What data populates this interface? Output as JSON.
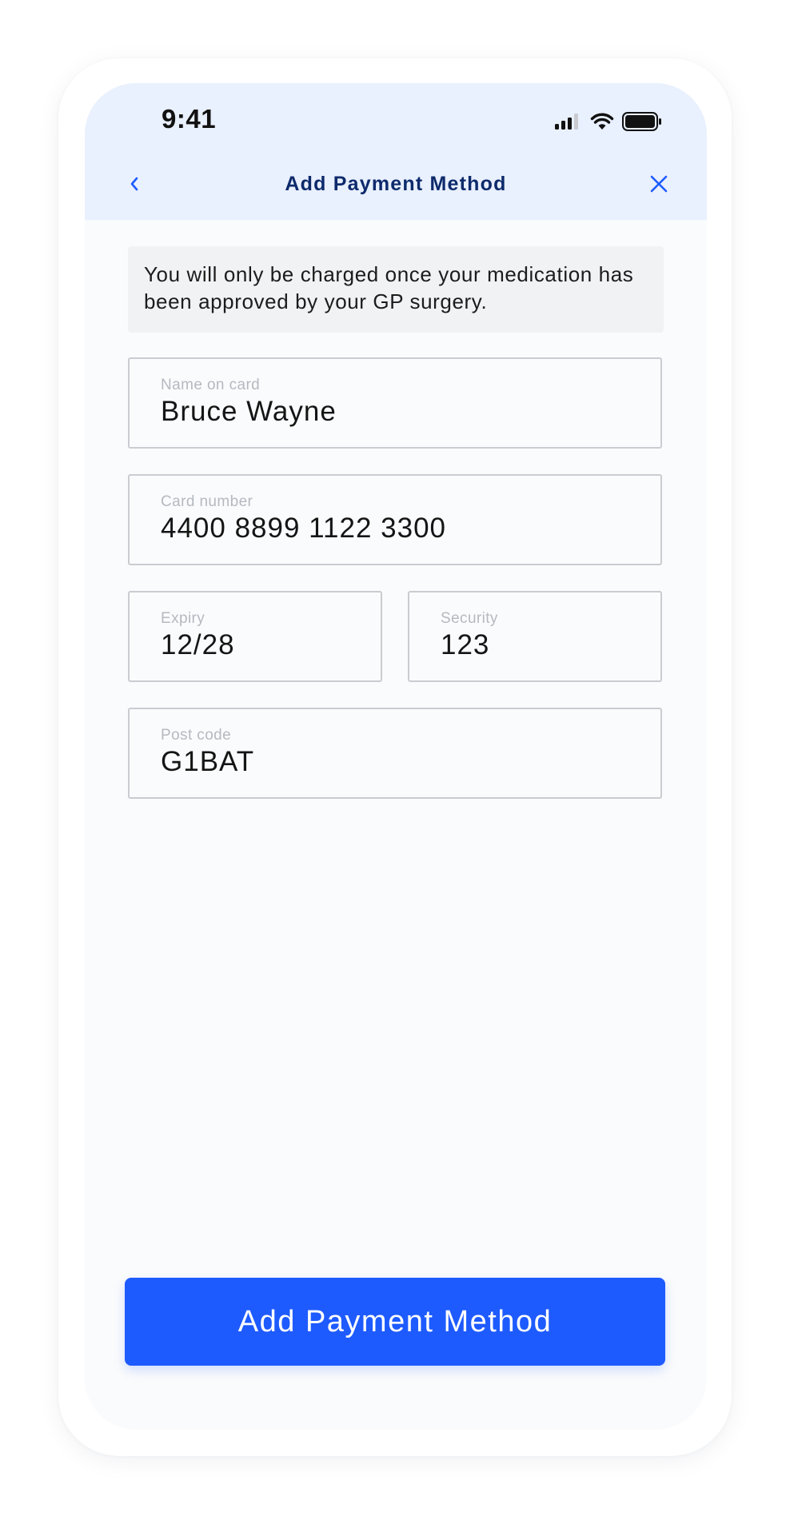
{
  "status_bar": {
    "time": "9:41",
    "icons": [
      "cellular-signal-icon",
      "wifi-icon",
      "battery-icon"
    ]
  },
  "nav": {
    "title": "Add Payment Method",
    "back_icon": "chevron-left-icon",
    "close_icon": "close-icon"
  },
  "notice": {
    "text": "You will only be charged once your medication has been approved by your GP surgery."
  },
  "form": {
    "name": {
      "label": "Name on card",
      "value": "Bruce Wayne"
    },
    "card_number": {
      "label": "Card number",
      "value": "4400 8899 1122 3300"
    },
    "expiry": {
      "label": "Expiry",
      "value": "12/28"
    },
    "security": {
      "label": "Security",
      "value": "123"
    },
    "postcode": {
      "label": "Post code",
      "value": "G1BAT"
    }
  },
  "primary_button": {
    "label": "Add Payment Method"
  },
  "colors": {
    "header_background": "#e9f0fe",
    "title_text": "#0d2a6b",
    "accent": "#1e5bff",
    "notice_background": "#f1f2f4",
    "field_border": "#c9ccd1"
  }
}
